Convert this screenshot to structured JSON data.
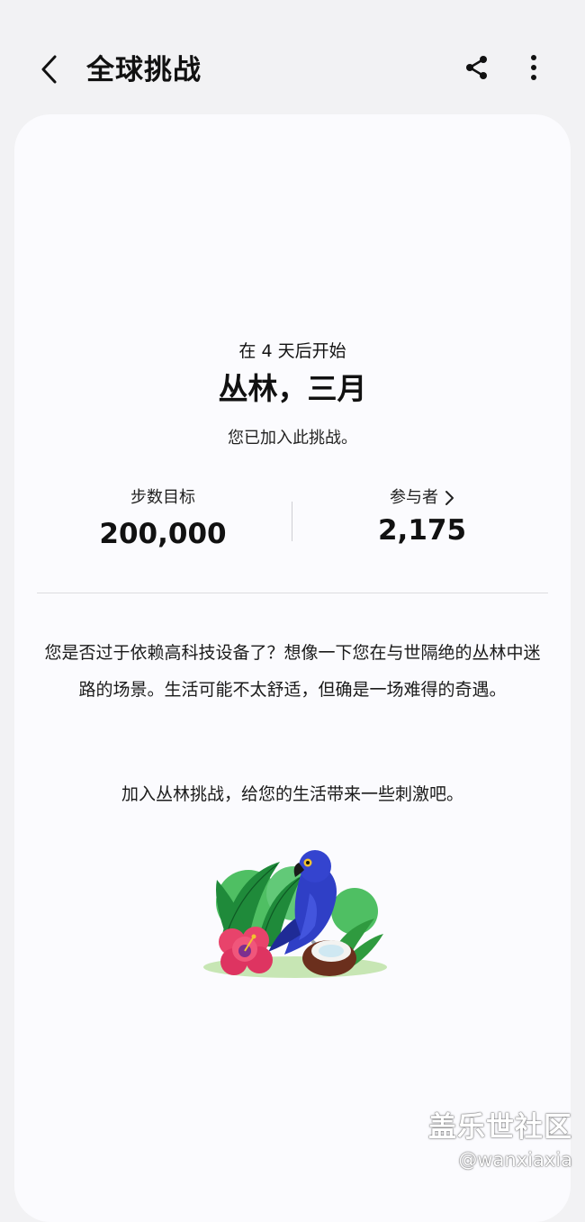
{
  "header": {
    "title": "全球挑战",
    "back_icon": "back-arrow-icon",
    "share_icon": "share-icon",
    "more_icon": "more-vertical-icon"
  },
  "challenge": {
    "start_text": "在 4 天后开始",
    "title": "丛林，三月",
    "joined_text": "您已加入此挑战。"
  },
  "stats": {
    "goal_label": "步数目标",
    "goal_value": "200,000",
    "participants_label": "参与者",
    "participants_value": "2,175"
  },
  "description": {
    "paragraph1": "您是否过于依赖高科技设备了？想像一下您在与世隔绝的丛林中迷路的场景。生活可能不太舒适，但确是一场难得的奇遇。",
    "paragraph2": "加入丛林挑战，给您的生活带来一些刺激吧。"
  },
  "watermark": {
    "line1": "盖乐世社区",
    "line2": "@wanxiaxia"
  },
  "colors": {
    "background": "#f2f2f4",
    "card": "#fbfbfe",
    "text": "#111111",
    "parrot": "#2f3fc6",
    "leaf": "#2f9a3f",
    "flower": "#e8436b"
  }
}
